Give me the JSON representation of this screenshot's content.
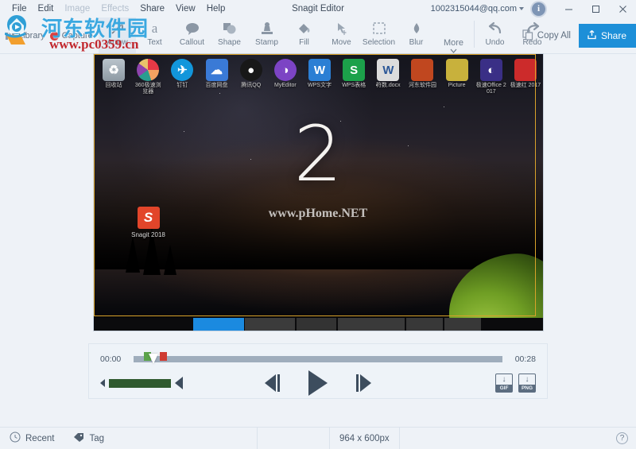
{
  "window": {
    "title": "Snagit Editor",
    "account_email": "1002315044@qq.com",
    "info_icon": "info-icon",
    "minimize": "—",
    "maximize": "□",
    "close": "✕"
  },
  "menubar": {
    "items": [
      {
        "label": "File",
        "enabled": true
      },
      {
        "label": "Edit",
        "enabled": true
      },
      {
        "label": "Image",
        "enabled": false
      },
      {
        "label": "Effects",
        "enabled": false
      },
      {
        "label": "Share",
        "enabled": true
      },
      {
        "label": "View",
        "enabled": true
      },
      {
        "label": "Help",
        "enabled": true
      }
    ]
  },
  "left_panel": {
    "library_label": "Library",
    "capture_label": "Capture"
  },
  "toolbar": {
    "tools": [
      {
        "label": "Arrow",
        "icon": "arrow-icon",
        "selected": true
      },
      {
        "label": "Text",
        "icon": "text-a-icon",
        "selected": false
      },
      {
        "label": "Callout",
        "icon": "callout-bubble-icon",
        "selected": false
      },
      {
        "label": "Shape",
        "icon": "shape-icon",
        "selected": false
      },
      {
        "label": "Stamp",
        "icon": "stamp-icon",
        "selected": false
      },
      {
        "label": "Fill",
        "icon": "paint-bucket-icon",
        "selected": false
      },
      {
        "label": "Move",
        "icon": "move-cursor-icon",
        "selected": false
      },
      {
        "label": "Selection",
        "icon": "marquee-selection-icon",
        "selected": false
      },
      {
        "label": "Blur",
        "icon": "blur-drop-icon",
        "selected": false
      },
      {
        "label": "More",
        "icon": "more-chevron-icon",
        "selected": false
      },
      {
        "label": "Undo",
        "icon": "undo-arrow-icon",
        "selected": false
      },
      {
        "label": "Redo",
        "icon": "redo-arrow-icon",
        "selected": false
      }
    ],
    "copy_all_label": "Copy All",
    "copy_all_icon": "copy-icon",
    "share_label": "Share",
    "share_icon": "share-upload-icon",
    "share_color": "#1d8fd8"
  },
  "canvas": {
    "countdown_number": "2",
    "center_watermark": "www.pHome.NET",
    "desktop_icons": [
      {
        "label": "回收站",
        "icon": "recycle-bin-icon",
        "color": "#9aa6ae",
        "glyph": "♻"
      },
      {
        "label": "360极速浏览器",
        "icon": "360-browser-icon",
        "color": "#e8d23a",
        "glyph": ""
      },
      {
        "label": "钉钉",
        "icon": "dingtalk-icon",
        "color": "#1296db",
        "glyph": "✈"
      },
      {
        "label": "百度网盘",
        "icon": "baidu-netdisk-icon",
        "color": "#3a7ad6",
        "glyph": "☁"
      },
      {
        "label": "腾讯QQ",
        "icon": "qq-penguin-icon",
        "color": "#2b2b2b",
        "glyph": ""
      },
      {
        "label": "MyEditor",
        "icon": "myeditor-icon",
        "color": "#7c44c4",
        "glyph": "◑"
      },
      {
        "label": "WPS文字",
        "icon": "wps-writer-icon",
        "color": "#2b7fd4",
        "glyph": "W"
      },
      {
        "label": "WPS表格",
        "icon": "wps-spreadsheet-icon",
        "color": "#1ca14a",
        "glyph": "S"
      },
      {
        "label": "符数.docx",
        "icon": "docx-file-icon",
        "color": "#dcdcdc",
        "glyph": "W"
      },
      {
        "label": "河东软件园",
        "icon": "folder-red-icon",
        "color": "#c0471f",
        "glyph": ""
      },
      {
        "label": "Picture",
        "icon": "folder-yellow-icon",
        "color": "#c8b13c",
        "glyph": ""
      },
      {
        "label": "极速Office 2017",
        "icon": "office-2017-icon",
        "color": "#3a2f86",
        "glyph": "◐"
      },
      {
        "label": "极速红 2017",
        "icon": "red-app-2017-icon",
        "color": "#cc2b2b",
        "glyph": ""
      }
    ],
    "desktop_snagit": {
      "label": "Snagit 2018",
      "icon": "snagit-icon",
      "glyph": "S"
    },
    "selection_border_color": "#d9a22a"
  },
  "player": {
    "time_start": "00:00",
    "time_end": "00:28",
    "start_marker": "trim-start-handle",
    "end_marker": "trim-end-handle",
    "playhead": "playhead-handle",
    "volume_icon": "speaker-icon",
    "volume_down_icon": "volume-decrease-icon",
    "prev_frame_icon": "previous-frame-icon",
    "play_icon": "play-icon",
    "next_frame_icon": "next-frame-icon",
    "export_gif_label": "GIF",
    "export_png_label": "PNG",
    "export_arrow": "↓"
  },
  "statusbar": {
    "recent_label": "Recent",
    "recent_icon": "clock-icon",
    "tag_label": "Tag",
    "tag_icon": "tag-icon",
    "dimensions": "964 x 600px",
    "help_label": "?"
  },
  "watermark": {
    "site_name": "河东软件园",
    "site_url": "www.pc0359.cn",
    "logo": "hedong-logo-icon"
  }
}
